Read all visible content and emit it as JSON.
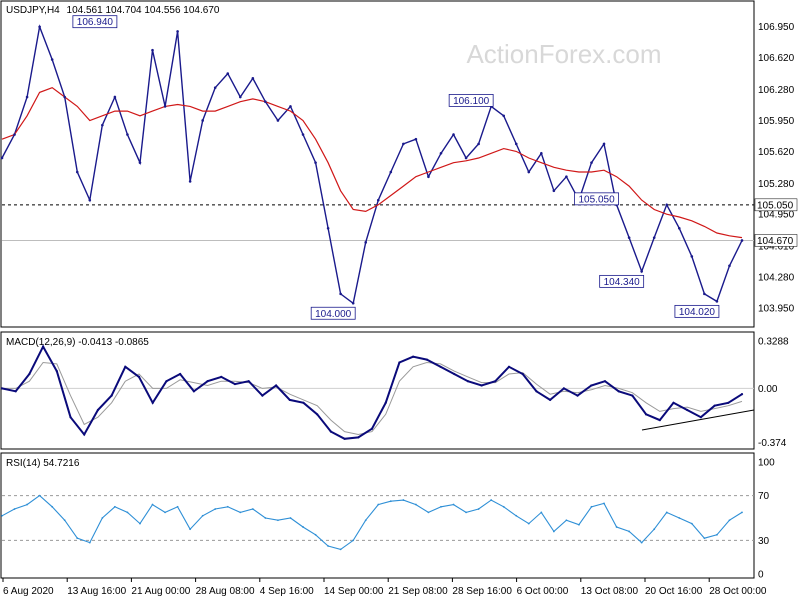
{
  "chart_data": {
    "type": "line",
    "header": {
      "symbol": "USDJPY,H4",
      "ohlc": "104.561 104.704 104.556 104.670"
    },
    "watermark": "ActionForex.com",
    "colors": {
      "price": "#1a1a8c",
      "ma": "#d01818",
      "macd": "#0a0a7a",
      "signal": "#9a9a9a",
      "rsi": "#2e8fd6",
      "grid_line": "#000000",
      "trendline": "#000000"
    },
    "x_labels": [
      "6 Aug 2020",
      "13 Aug 16:00",
      "21 Aug 00:00",
      "28 Aug 08:00",
      "4 Sep 16:00",
      "14 Sep 00:00",
      "21 Sep 08:00",
      "28 Sep 16:00",
      "6 Oct 00:00",
      "13 Oct 08:00",
      "20 Oct 16:00",
      "28 Oct 00:00"
    ],
    "price_panel": {
      "ylim": [
        103.8,
        107.15
      ],
      "y_ticks": [
        "106.950",
        "106.620",
        "106.280",
        "105.950",
        "105.620",
        "105.280",
        "104.950",
        "104.610",
        "104.280",
        "103.950"
      ],
      "tick_values": [
        106.95,
        106.62,
        106.28,
        105.95,
        105.62,
        105.28,
        104.95,
        104.61,
        104.28,
        103.95
      ],
      "series": [
        {
          "name": "Price",
          "values": [
            105.55,
            105.8,
            106.2,
            106.95,
            106.6,
            106.2,
            105.4,
            105.1,
            105.9,
            106.2,
            105.8,
            105.5,
            106.7,
            106.1,
            106.9,
            105.3,
            105.95,
            106.3,
            106.45,
            106.2,
            106.4,
            106.15,
            105.95,
            106.1,
            105.8,
            105.5,
            104.8,
            104.1,
            104.0,
            104.65,
            105.1,
            105.4,
            105.7,
            105.75,
            105.35,
            105.6,
            105.8,
            105.55,
            105.7,
            106.1,
            106.0,
            105.7,
            105.4,
            105.6,
            105.2,
            105.35,
            105.1,
            105.5,
            105.7,
            105.05,
            104.7,
            104.34,
            104.7,
            105.05,
            104.8,
            104.5,
            104.1,
            104.02,
            104.4,
            104.67
          ]
        },
        {
          "name": "MA",
          "values": [
            105.75,
            105.8,
            106.0,
            106.25,
            106.3,
            106.2,
            106.1,
            105.95,
            106.0,
            106.05,
            106.05,
            106.0,
            106.05,
            106.1,
            106.12,
            106.1,
            106.05,
            106.05,
            106.1,
            106.15,
            106.18,
            106.15,
            106.1,
            106.05,
            105.95,
            105.75,
            105.5,
            105.2,
            105.0,
            104.98,
            105.05,
            105.15,
            105.25,
            105.35,
            105.4,
            105.45,
            105.5,
            105.52,
            105.55,
            105.6,
            105.65,
            105.62,
            105.55,
            105.5,
            105.45,
            105.42,
            105.4,
            105.4,
            105.42,
            105.35,
            105.25,
            105.1,
            105.0,
            104.95,
            104.92,
            104.88,
            104.82,
            104.75,
            104.72,
            104.7
          ]
        }
      ],
      "level_line": 105.05,
      "level_label": "105.050",
      "current_label": "104.670",
      "annotations": [
        {
          "text": "106.940",
          "x_index": 9,
          "y": 106.94
        },
        {
          "text": "104.000",
          "x_index": 28,
          "y": 104.0
        },
        {
          "text": "106.100",
          "x_index": 39,
          "y": 106.1
        },
        {
          "text": "105.050",
          "x_index": 49,
          "y": 105.05
        },
        {
          "text": "104.340",
          "x_index": 51,
          "y": 104.34
        },
        {
          "text": "104.020",
          "x_index": 57,
          "y": 104.02
        }
      ]
    },
    "macd_panel": {
      "label": "MACD(12,26,9) -0.0413 -0.0865",
      "ylim": [
        -0.4,
        0.35
      ],
      "y_ticks": [
        "0.3288",
        "0.00",
        "-0.374"
      ],
      "tick_values": [
        0.3288,
        0.0,
        -0.374
      ],
      "series": [
        {
          "name": "MACD",
          "values": [
            0.0,
            -0.02,
            0.1,
            0.29,
            0.12,
            -0.2,
            -0.32,
            -0.15,
            -0.05,
            0.15,
            0.08,
            -0.1,
            0.05,
            0.1,
            -0.02,
            0.05,
            0.08,
            0.03,
            0.05,
            -0.05,
            0.02,
            -0.08,
            -0.1,
            -0.18,
            -0.3,
            -0.35,
            -0.34,
            -0.28,
            -0.1,
            0.18,
            0.22,
            0.2,
            0.15,
            0.1,
            0.05,
            0.02,
            0.05,
            0.15,
            0.1,
            -0.02,
            -0.08,
            0.0,
            -0.05,
            0.02,
            0.05,
            -0.02,
            -0.05,
            -0.18,
            -0.22,
            -0.1,
            -0.15,
            -0.2,
            -0.12,
            -0.1,
            -0.04
          ]
        },
        {
          "name": "Signal",
          "values": [
            0.0,
            0.0,
            0.05,
            0.18,
            0.17,
            -0.05,
            -0.25,
            -0.2,
            -0.1,
            0.05,
            0.1,
            0.0,
            0.0,
            0.06,
            0.04,
            0.02,
            0.05,
            0.05,
            0.04,
            0.0,
            0.01,
            -0.04,
            -0.08,
            -0.12,
            -0.22,
            -0.3,
            -0.32,
            -0.3,
            -0.18,
            0.05,
            0.15,
            0.18,
            0.17,
            0.12,
            0.08,
            0.04,
            0.04,
            0.1,
            0.11,
            0.03,
            -0.04,
            -0.02,
            -0.03,
            -0.01,
            0.02,
            0.0,
            -0.03,
            -0.1,
            -0.16,
            -0.14,
            -0.13,
            -0.16,
            -0.14,
            -0.12,
            -0.09
          ]
        }
      ]
    },
    "rsi_panel": {
      "label": "RSI(14) 54.7216",
      "ylim": [
        0,
        100
      ],
      "y_ticks": [
        "100",
        "70",
        "30",
        "0"
      ],
      "tick_values": [
        100,
        70,
        30,
        0
      ],
      "levels": [
        70,
        30
      ],
      "series": [
        {
          "name": "RSI",
          "values": [
            52,
            58,
            62,
            70,
            60,
            48,
            32,
            28,
            50,
            60,
            55,
            45,
            62,
            55,
            60,
            40,
            52,
            58,
            60,
            55,
            58,
            50,
            48,
            50,
            42,
            35,
            25,
            22,
            30,
            48,
            62,
            65,
            66,
            62,
            55,
            60,
            62,
            55,
            58,
            66,
            60,
            52,
            45,
            55,
            38,
            48,
            44,
            60,
            63,
            42,
            38,
            28,
            40,
            55,
            50,
            45,
            32,
            35,
            48,
            55
          ]
        }
      ]
    }
  }
}
